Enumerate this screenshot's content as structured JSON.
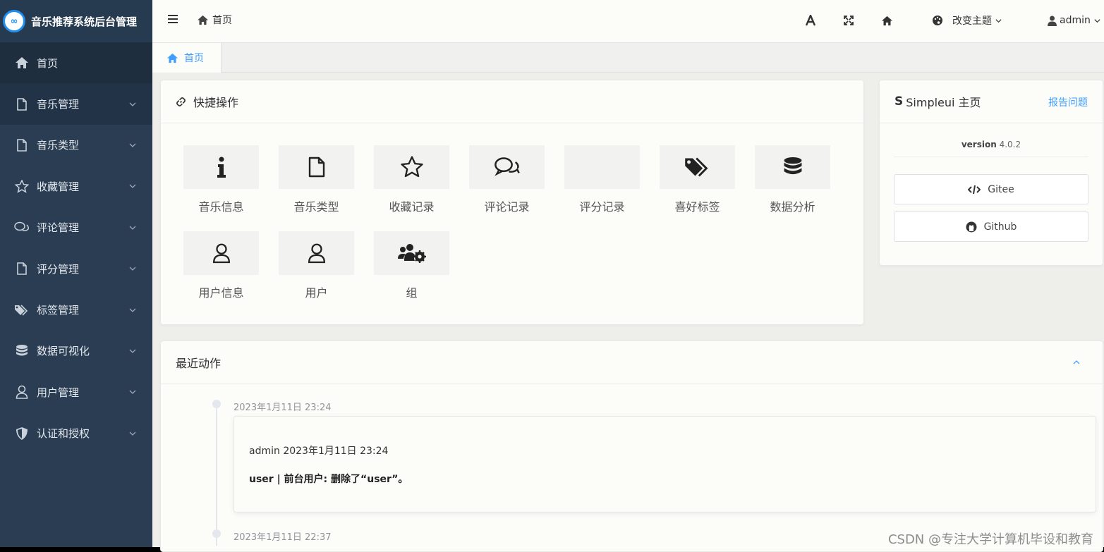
{
  "app": {
    "logo_glyph": "∞",
    "title": "音乐推荐系统后台管理"
  },
  "sidebar": {
    "items": [
      {
        "label": "首页",
        "icon": "home-icon"
      },
      {
        "label": "音乐管理",
        "icon": "file-icon"
      },
      {
        "label": "音乐类型",
        "icon": "file-icon"
      },
      {
        "label": "收藏管理",
        "icon": "star-icon"
      },
      {
        "label": "评论管理",
        "icon": "comments-icon"
      },
      {
        "label": "评分管理",
        "icon": "file-icon"
      },
      {
        "label": "标签管理",
        "icon": "tags-icon"
      },
      {
        "label": "数据可视化",
        "icon": "database-icon"
      },
      {
        "label": "用户管理",
        "icon": "user-icon"
      },
      {
        "label": "认证和授权",
        "icon": "shield-icon"
      }
    ]
  },
  "header": {
    "breadcrumb": "首页",
    "theme_label": "改变主题",
    "user_label": "admin"
  },
  "tabs": [
    {
      "label": "首页"
    }
  ],
  "quick_actions": {
    "title": "快捷操作",
    "items": [
      {
        "label": "音乐信息",
        "icon": "info-icon"
      },
      {
        "label": "音乐类型",
        "icon": "file-icon"
      },
      {
        "label": "收藏记录",
        "icon": "star-icon"
      },
      {
        "label": "评论记录",
        "icon": "comments-icon"
      },
      {
        "label": "评分记录",
        "icon": "none"
      },
      {
        "label": "喜好标签",
        "icon": "tags-icon"
      },
      {
        "label": "数据分析",
        "icon": "database-icon"
      },
      {
        "label": "用户信息",
        "icon": "user-icon"
      },
      {
        "label": "用户",
        "icon": "user-icon"
      },
      {
        "label": "组",
        "icon": "users-cog-icon"
      }
    ]
  },
  "simpleui": {
    "title": "Simpleui 主页",
    "report_link": "报告问题",
    "version_label": "version",
    "version_value": "4.0.2",
    "gitee_label": "Gitee",
    "github_label": "Github"
  },
  "recent": {
    "title": "最近动作",
    "entries": [
      {
        "time": "2023年1月11日 23:24",
        "who": "admin 2023年1月11日 23:24",
        "message": "user | 前台用户: 删除了“user”。"
      },
      {
        "time": "2023年1月11日 22:37"
      }
    ]
  },
  "watermark": "CSDN @专注大学计算机毕设和教育",
  "colors": {
    "sidebar": "#2b3d53",
    "accent": "#409eff"
  }
}
